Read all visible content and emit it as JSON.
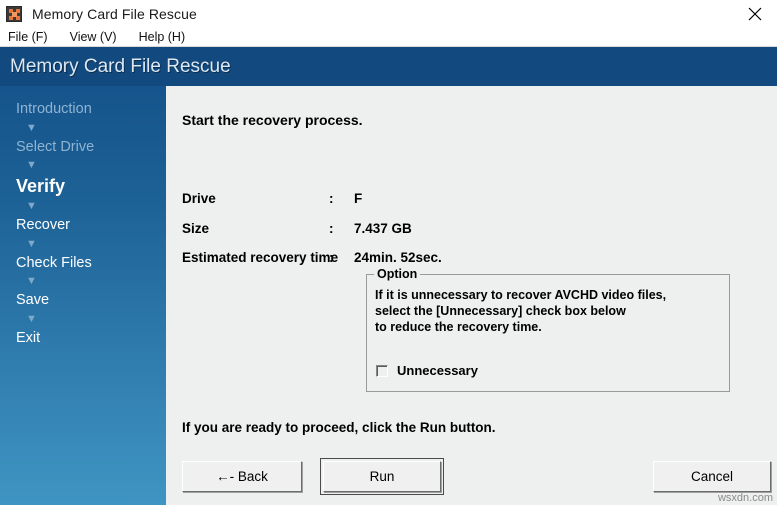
{
  "window": {
    "title": "Memory Card File Rescue",
    "icon": "memory-card-icon",
    "close_icon": "close-icon"
  },
  "menubar": {
    "items": [
      {
        "label": "File (F)"
      },
      {
        "label": "View (V)"
      },
      {
        "label": "Help (H)"
      }
    ]
  },
  "banner": {
    "title": "Memory Card File Rescue",
    "background": "#12497e"
  },
  "sidebar": {
    "background_top": "#15548c",
    "background_bottom": "#3f95c2",
    "arrow_glyph": "▼",
    "steps": [
      {
        "label": "Introduction",
        "state": "done"
      },
      {
        "label": "Select Drive",
        "state": "done"
      },
      {
        "label": "Verify",
        "state": "current"
      },
      {
        "label": "Recover",
        "state": "upcoming"
      },
      {
        "label": "Check Files",
        "state": "upcoming"
      },
      {
        "label": "Save",
        "state": "upcoming"
      },
      {
        "label": "Exit",
        "state": "upcoming"
      }
    ]
  },
  "main": {
    "heading": "Start the recovery process.",
    "separator": ":",
    "info": [
      {
        "label": "Drive",
        "value": "F"
      },
      {
        "label": "Size",
        "value": "7.437 GB"
      },
      {
        "label": "Estimated recovery time",
        "value": "24min. 52sec."
      }
    ],
    "option_group": {
      "legend": "Option",
      "line1": "If it is unnecessary to recover AVCHD video files,",
      "line2": "select the [Unnecessary] check box below",
      "line3": "to reduce the recovery time.",
      "checkbox_label": "Unnecessary",
      "checkbox_checked": false
    },
    "proceed_text": "If you are ready to proceed, click the Run button.",
    "buttons": {
      "back": "←- Back",
      "run": "Run",
      "cancel": "Cancel"
    }
  },
  "watermark": "wsxdn.com"
}
